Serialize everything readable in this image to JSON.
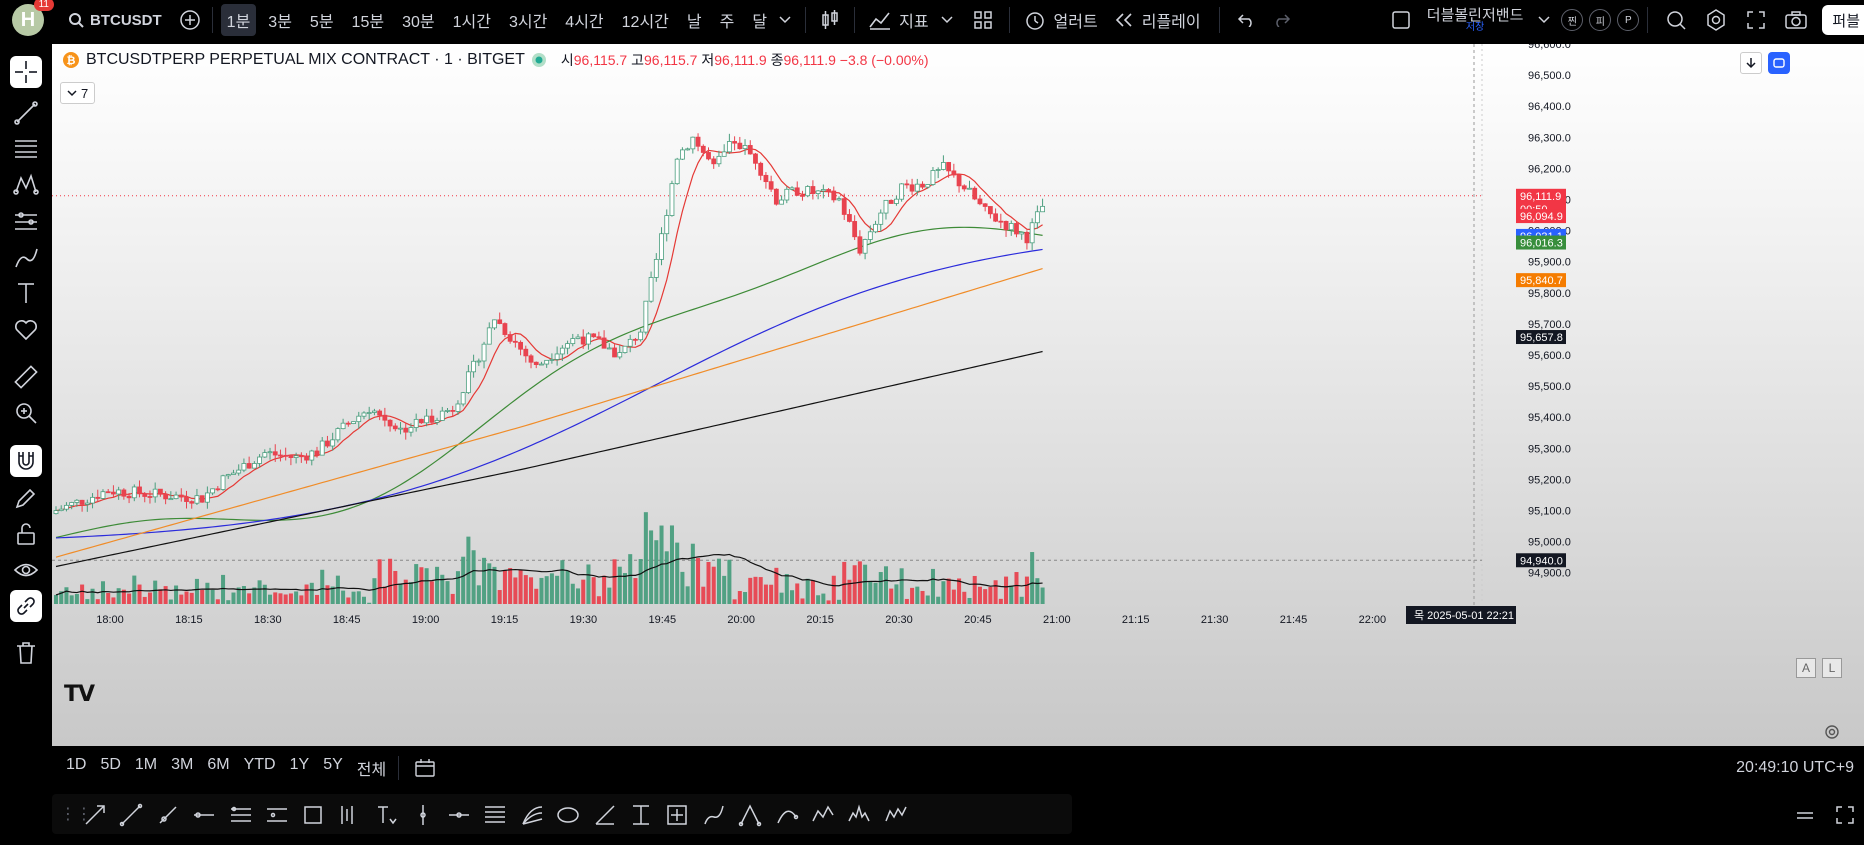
{
  "header": {
    "avatar_letter": "H",
    "notifications": "11",
    "symbol": "BTCUSDT",
    "intervals": [
      "1분",
      "3분",
      "5분",
      "15분",
      "30분",
      "1시간",
      "3시간",
      "4시간",
      "12시간",
      "날",
      "주",
      "달"
    ],
    "active_interval": "1분",
    "indicators_label": "지표",
    "alert_label": "얼러트",
    "replay_label": "리플레이",
    "layout_name": "더블볼린저밴드",
    "layout_sub": "저장",
    "circle_buttons": [
      "찐",
      "피",
      "P"
    ],
    "publish_label": "퍼블"
  },
  "legend": {
    "title": "BTCUSDTPERP PERPETUAL MIX CONTRACT · 1 · BITGET",
    "o_label": "시",
    "o": "96,115.7",
    "h_label": "고",
    "h": "96,115.7",
    "l_label": "저",
    "l": "96,111.9",
    "c_label": "종",
    "c": "96,111.9",
    "chg": "−3.8 (−0.00%)",
    "collapse_count": "7"
  },
  "price_axis": {
    "ticks": [
      "96,600.0",
      "96,500.0",
      "96,400.0",
      "96,300.0",
      "96,200.0",
      "96,100.0",
      "96,000.0",
      "95,900.0",
      "95,800.0",
      "95,700.0",
      "95,600.0",
      "95,500.0",
      "95,400.0",
      "95,300.0",
      "95,200.0",
      "95,100.0",
      "95,000.0",
      "94,900.0"
    ],
    "labels": [
      {
        "text": "96,111.9",
        "color": "#f23645"
      },
      {
        "text": "00:50",
        "color": "#f23645"
      },
      {
        "text": "96,094.9",
        "color": "#f23645"
      },
      {
        "text": "96,031.1",
        "color": "#2962ff"
      },
      {
        "text": "96,016.3",
        "color": "#388e3c"
      },
      {
        "text": "95,840.7",
        "color": "#f57c00"
      },
      {
        "text": "95,657.8",
        "color": "#131722"
      },
      {
        "text": "94,940.0",
        "color": "#131722"
      }
    ]
  },
  "time_axis": {
    "ticks": [
      "18:00",
      "18:15",
      "18:30",
      "18:45",
      "19:00",
      "19:15",
      "19:30",
      "19:45",
      "20:00",
      "20:15",
      "20:30",
      "20:45",
      "21:00",
      "21:15",
      "21:30",
      "21:45",
      "22:00"
    ],
    "cursor_label": "목 2025-05-01   22:21"
  },
  "bottom": {
    "ranges": [
      "1D",
      "5D",
      "1M",
      "3M",
      "6M",
      "YTD",
      "1Y",
      "5Y",
      "전체"
    ],
    "clock": "20:49:10 UTC+9"
  },
  "colors": {
    "up": "#4a9e7e",
    "down": "#e8434f",
    "ma_red": "#e53935",
    "ma_green": "#3d8b37",
    "ma_blue": "#2b2bdb",
    "ma_orange": "#f08c28",
    "ma_black": "#111111"
  },
  "axis_markers": {
    "scale_a": "A",
    "scale_l": "L"
  },
  "watermark": "TV"
}
